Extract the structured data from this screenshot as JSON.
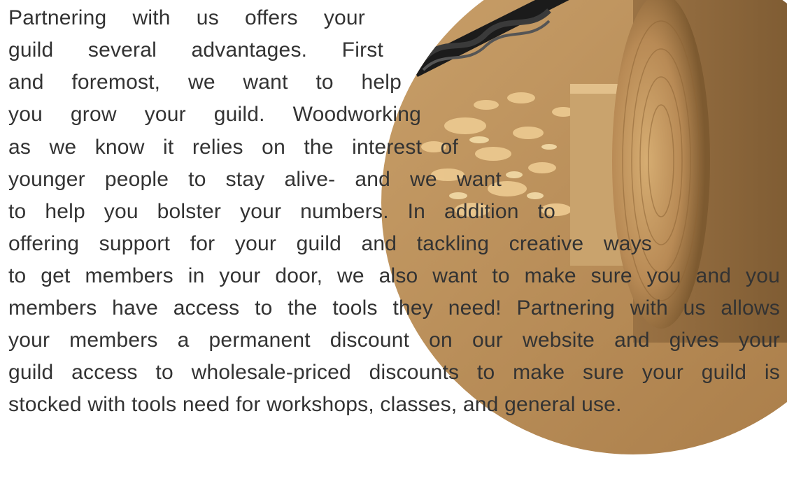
{
  "paragraph": {
    "lines": [
      "Partnering with us offers your",
      "guild several advantages. First",
      "and foremost, we want to help",
      "you grow your guild. Woodworking",
      "as we know it relies on the interest of",
      "younger people to stay alive- and we want",
      "to help you bolster your numbers. In addition to",
      "offering support for your guild and tackling creative ways",
      "to get members in your door, we also want to make sure you and you",
      "members have access to the tools they need! Partnering with us allows",
      "your members a permanent discount on our website and gives your",
      "guild access to wholesale-priced discounts to make sure your guild is",
      "stocked with tools need for workshops, classes, and general use."
    ]
  },
  "image": {
    "icon": "woodworking-auger-bit-photo",
    "colors": {
      "wood_light": "#d9b37a",
      "wood_mid": "#b98a52",
      "wood_dark": "#8a6232",
      "shavings": "#e8c48a",
      "bit": "#1a1a1a"
    }
  },
  "colors": {
    "text": "#333333",
    "background": "#ffffff"
  }
}
